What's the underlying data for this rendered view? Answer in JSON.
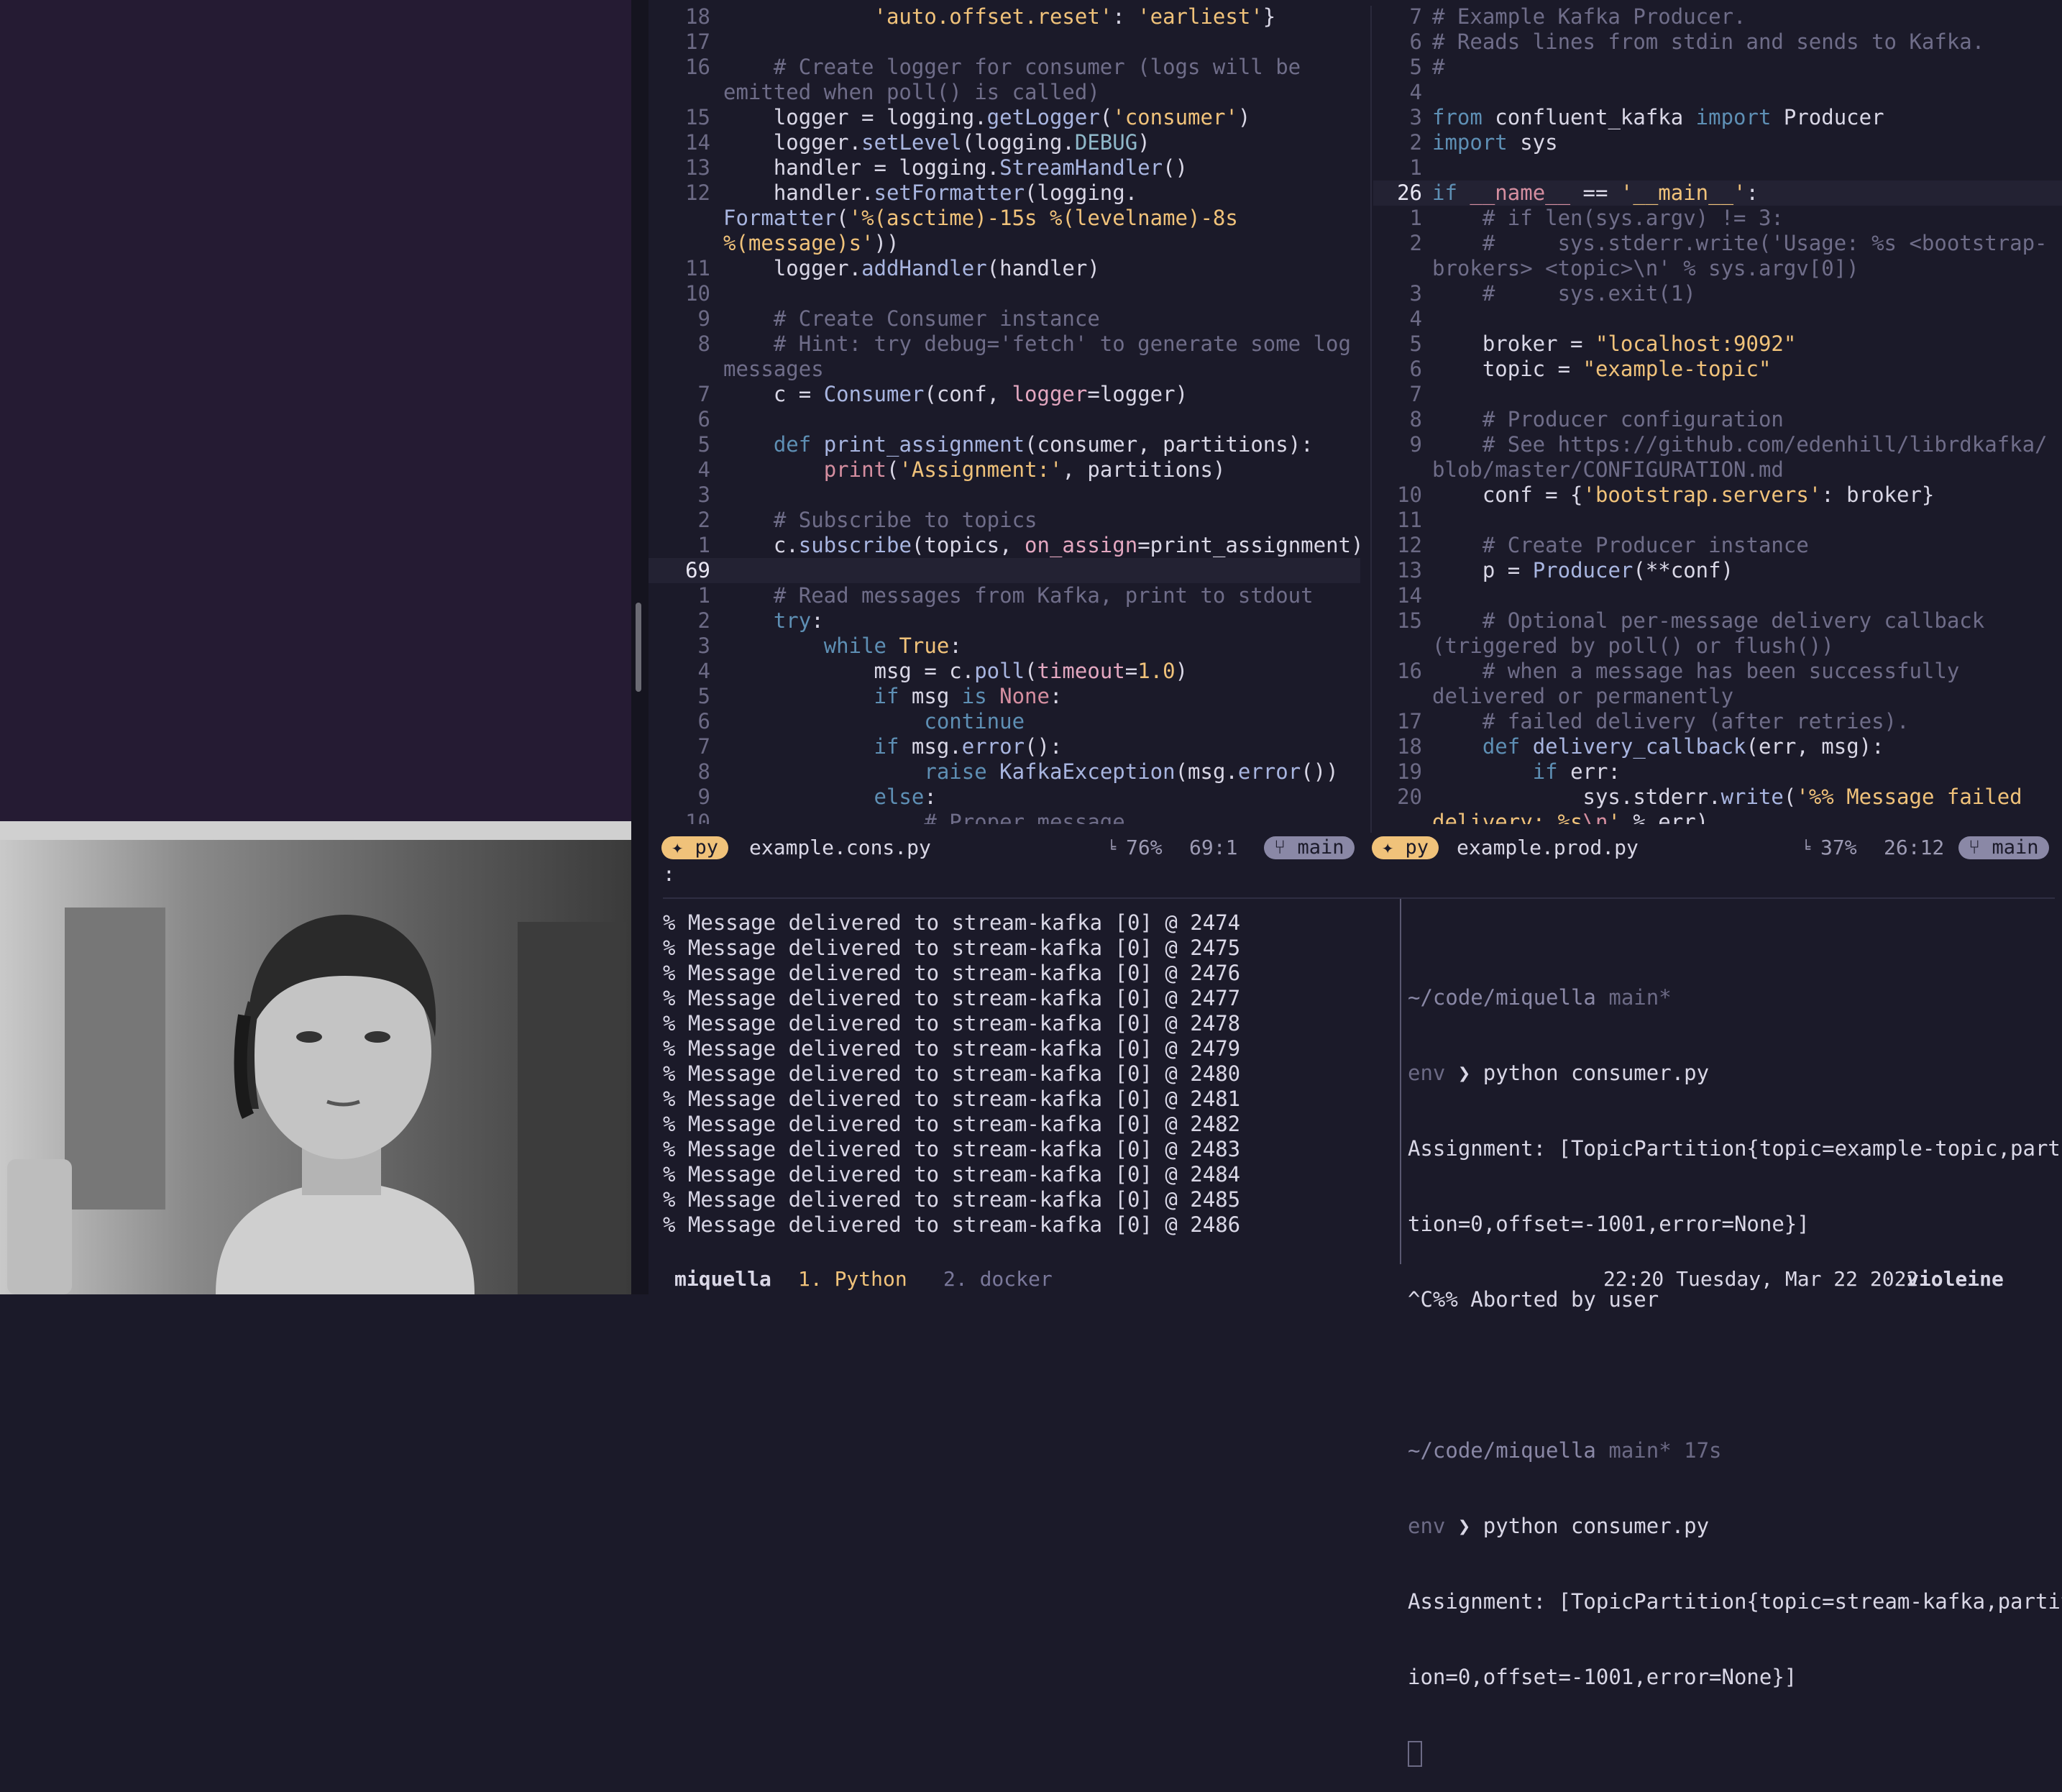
{
  "editor_left": {
    "filename": "example.cons.py",
    "filetype": "py",
    "scroll_percent": "76%",
    "position": "69:1",
    "branch": "main",
    "lines": [
      {
        "n": "18",
        "html": "            <span class='st'>'auto.offset.reset'</span>: <span class='st'>'earliest'</span>}"
      },
      {
        "n": "17",
        "html": ""
      },
      {
        "n": "16",
        "html": "    <span class='cm'># Create logger for consumer (logs will be</span>"
      },
      {
        "n": "",
        "html": "<span class='cm'>emitted when poll() is called)</span>"
      },
      {
        "n": "15",
        "html": "    logger = logging.<span class='fn'>getLogger</span>(<span class='st'>'consumer'</span>)"
      },
      {
        "n": "14",
        "html": "    logger.<span class='fn'>setLevel</span>(logging.<span class='cy'>DEBUG</span>)"
      },
      {
        "n": "13",
        "html": "    handler = logging.<span class='fn'>StreamHandler</span>()"
      },
      {
        "n": "12",
        "html": "    handler.<span class='fn'>setFormatter</span>(logging."
      },
      {
        "n": "",
        "html": "<span class='fn'>Formatter</span>(<span class='st'>'%(asctime)-15s %(levelname)-8s</span>"
      },
      {
        "n": "",
        "html": "<span class='st'>%(message)s'</span>))"
      },
      {
        "n": "11",
        "html": "    logger.<span class='fn'>addHandler</span>(handler)"
      },
      {
        "n": "10",
        "html": ""
      },
      {
        "n": "9",
        "html": "    <span class='cm'># Create Consumer instance</span>"
      },
      {
        "n": "8",
        "html": "    <span class='cm'># Hint: try debug='fetch' to generate some log</span>"
      },
      {
        "n": "",
        "html": "<span class='cm'>messages</span>"
      },
      {
        "n": "7",
        "html": "    c = <span class='fn'>Consumer</span>(conf, <span class='ty'>logger</span>=logger)"
      },
      {
        "n": "6",
        "html": ""
      },
      {
        "n": "5",
        "html": "    <span class='kw'>def</span> <span class='fn'>print_assignment</span>(consumer, partitions):"
      },
      {
        "n": "4",
        "html": "        <span class='mg'>print</span>(<span class='st'>'Assignment:'</span>, partitions)"
      },
      {
        "n": "3",
        "html": ""
      },
      {
        "n": "2",
        "html": "    <span class='cm'># Subscribe to topics</span>"
      },
      {
        "n": "1",
        "html": "    c.<span class='fn'>subscribe</span>(topics, <span class='ty'>on_assign</span>=print_assignment)"
      },
      {
        "n": "69",
        "html": "",
        "current": true
      },
      {
        "n": "1",
        "html": "    <span class='cm'># Read messages from Kafka, print to stdout</span>"
      },
      {
        "n": "2",
        "html": "    <span class='kw'>try</span>:"
      },
      {
        "n": "3",
        "html": "        <span class='kw'>while</span> <span class='nm'>True</span>:"
      },
      {
        "n": "4",
        "html": "            msg = c.<span class='fn'>poll</span>(<span class='ty'>timeout</span>=<span class='nm'>1.0</span>)"
      },
      {
        "n": "5",
        "html": "            <span class='kw'>if</span> msg <span class='kw'>is</span> <span class='mg'>None</span>:"
      },
      {
        "n": "6",
        "html": "                <span class='kw'>continue</span>"
      },
      {
        "n": "7",
        "html": "            <span class='kw'>if</span> msg.<span class='fn'>error</span>():"
      },
      {
        "n": "8",
        "html": "                <span class='kw'>raise</span> <span class='fn'>KafkaException</span>(msg.<span class='fn'>error</span>())"
      },
      {
        "n": "9",
        "html": "            <span class='kw'>else</span>:"
      },
      {
        "n": "10",
        "html": "                <span class='cm'># Proper message</span>"
      }
    ]
  },
  "editor_right": {
    "filename": "example.prod.py",
    "filetype": "py",
    "scroll_percent": "37%",
    "position": "26:12",
    "branch": "main",
    "lines": [
      {
        "n": "7",
        "html": "<span class='cm'># Example Kafka Producer.</span>"
      },
      {
        "n": "6",
        "html": "<span class='cm'># Reads lines from stdin and sends to Kafka.</span>"
      },
      {
        "n": "5",
        "html": "<span class='cm'>#</span>"
      },
      {
        "n": "4",
        "html": ""
      },
      {
        "n": "3",
        "html": "<span class='kw'>from</span> confluent_kafka <span class='kw'>import</span> Producer"
      },
      {
        "n": "2",
        "html": "<span class='kw'>import</span> sys"
      },
      {
        "n": "1",
        "html": ""
      },
      {
        "n": "26",
        "html": "<span class='kw'>if</span> <span class='mg'>__name__</span> == <span class='st'>'__main__'</span>:",
        "current": true
      },
      {
        "n": "1",
        "html": "    <span class='cm'># if len(sys.argv) != 3:</span>"
      },
      {
        "n": "2",
        "html": "    <span class='cm'>#     sys.stderr.write('Usage: %s &lt;bootstrap-</span>"
      },
      {
        "n": "",
        "html": "<span class='cm'>brokers&gt; &lt;topic&gt;\\n' % sys.argv[0])</span>"
      },
      {
        "n": "3",
        "html": "    <span class='cm'>#     sys.exit(1)</span>"
      },
      {
        "n": "4",
        "html": ""
      },
      {
        "n": "5",
        "html": "    broker = <span class='st'>\"localhost:9092\"</span>"
      },
      {
        "n": "6",
        "html": "    topic = <span class='st'>\"example-topic\"</span>"
      },
      {
        "n": "7",
        "html": ""
      },
      {
        "n": "8",
        "html": "    <span class='cm'># Producer configuration</span>"
      },
      {
        "n": "9",
        "html": "    <span class='cm'># See https://github.com/edenhill/librdkafka/</span>"
      },
      {
        "n": "",
        "html": "<span class='cm'>blob/master/CONFIGURATION.md</span>"
      },
      {
        "n": "10",
        "html": "    conf = {<span class='st'>'bootstrap.servers'</span>: broker}"
      },
      {
        "n": "11",
        "html": ""
      },
      {
        "n": "12",
        "html": "    <span class='cm'># Create Producer instance</span>"
      },
      {
        "n": "13",
        "html": "    p = <span class='fn'>Producer</span>(**conf)"
      },
      {
        "n": "14",
        "html": ""
      },
      {
        "n": "15",
        "html": "    <span class='cm'># Optional per-message delivery callback</span>"
      },
      {
        "n": "",
        "html": "<span class='cm'>(triggered by poll() or flush())</span>"
      },
      {
        "n": "16",
        "html": "    <span class='cm'># when a message has been successfully</span>"
      },
      {
        "n": "",
        "html": "<span class='cm'>delivered or permanently</span>"
      },
      {
        "n": "17",
        "html": "    <span class='cm'># failed delivery (after retries).</span>"
      },
      {
        "n": "18",
        "html": "    <span class='kw'>def</span> <span class='fn'>delivery_callback</span>(err, msg):"
      },
      {
        "n": "19",
        "html": "        <span class='kw'>if</span> err:"
      },
      {
        "n": "20",
        "html": "            sys.stderr.<span class='fn'>write</span>(<span class='st'>'%% Message failed</span>"
      },
      {
        "n": "",
        "html": "<span class='st'>delivery: %s</span><span class='mg'>\\n</span><span class='st'>'</span> % err)"
      }
    ]
  },
  "cmdline": ":",
  "terminal_left": [
    "% Message delivered to stream-kafka [0] @ 2474",
    "% Message delivered to stream-kafka [0] @ 2475",
    "% Message delivered to stream-kafka [0] @ 2476",
    "% Message delivered to stream-kafka [0] @ 2477",
    "% Message delivered to stream-kafka [0] @ 2478",
    "% Message delivered to stream-kafka [0] @ 2479",
    "% Message delivered to stream-kafka [0] @ 2480",
    "% Message delivered to stream-kafka [0] @ 2481",
    "% Message delivered to stream-kafka [0] @ 2482",
    "% Message delivered to stream-kafka [0] @ 2483",
    "% Message delivered to stream-kafka [0] @ 2484",
    "% Message delivered to stream-kafka [0] @ 2485",
    "% Message delivered to stream-kafka [0] @ 2486"
  ],
  "terminal_right": {
    "prompt1_path": "~/code/miquella",
    "prompt1_branch": "main*",
    "env1": "env",
    "cmd1": "python consumer.py",
    "out1a": "Assignment: [TopicPartition{topic=example-topic,parti",
    "out1b": "tion=0,offset=-1001,error=None}]",
    "out1c": "^C%% Aborted by user",
    "prompt2_path": "~/code/miquella",
    "prompt2_branch": "main* 17s",
    "env2": "env",
    "cmd2": "python consumer.py",
    "out2a": "Assignment: [TopicPartition{topic=stream-kafka,partit",
    "out2b": "ion=0,offset=-1001,error=None}]"
  },
  "tmux": {
    "session": "miquella",
    "window1": "1. Python",
    "window2": "2. docker",
    "datetime": "22:20 Tuesday, Mar 22 2022",
    "host": "violeine"
  },
  "icons": {
    "filetype": "python-icon",
    "branch": "git-branch-icon",
    "lock": "readonly-icon"
  }
}
